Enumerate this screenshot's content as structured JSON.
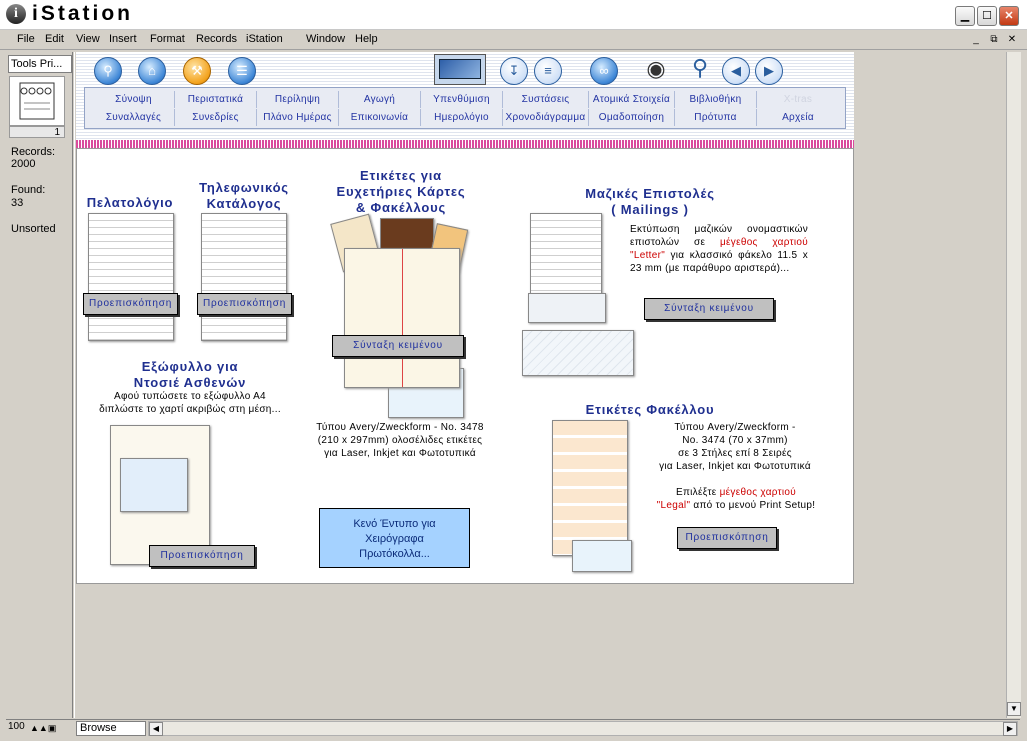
{
  "window": {
    "title": "iStation",
    "logo": "i",
    "minimize": "▁",
    "maximize": "☐",
    "close": "✕"
  },
  "menu": [
    "File",
    "Edit",
    "View",
    "Insert",
    "Format",
    "Records",
    "iStation",
    "Window",
    "Help"
  ],
  "mdi_controls": [
    "_",
    "⧉",
    "✕"
  ],
  "sidebar": {
    "layout_select": "Tools Pri...",
    "record_number": "1",
    "records_label": "Records:",
    "records_value": "2000",
    "found_label": "Found:",
    "found_value": "33",
    "sort_status": "Unsorted"
  },
  "toolbar": {
    "icons": [
      "search-icon",
      "home-icon",
      "tools-icon",
      "list-icon",
      "card-icon",
      "sort-down-icon",
      "sort-list-icon",
      "link-icon",
      "eye-icon",
      "magnifier-icon",
      "back-icon",
      "forward-icon"
    ],
    "nav_row1": [
      "Σύνοψη",
      "Περιστατικά",
      "Περίληψη",
      "Αγωγή",
      "Υπενθύμιση",
      "Συστάσεις",
      "Ατομικά Στοιχεία",
      "Βιβλιοθήκη",
      "X-tras"
    ],
    "nav_row2": [
      "Συναλλαγές",
      "Συνεδρίες",
      "Πλάνο Ημέρας",
      "Επικοινωνία",
      "Ημερολόγιο",
      "Χρονοδιάγραμμα",
      "Ομαδοποίηση",
      "Πρότυπα",
      "Αρχεία"
    ]
  },
  "page": {
    "client_list": {
      "title": "Πελατολόγιο",
      "button": "Προεπισκόπηση"
    },
    "phone_directory": {
      "title_line1": "Τηλεφωνικός",
      "title_line2": "Κατάλογος",
      "button": "Προεπισκόπηση"
    },
    "greeting_labels": {
      "title_line1": "Ετικέτες για",
      "title_line2": "Ευχετήριες Κάρτες",
      "title_line3": "& Φακέλλους",
      "button": "Σύνταξη κειμένου",
      "desc_line1": "Τύπου Avery/Zweckform - No. 3478",
      "desc_line2": "(210 x 297mm) ολοσέλιδες ετικέτες",
      "desc_line3": "για Laser, Inkjet και Φωτοτυπικά"
    },
    "mass_letters": {
      "title_line1": "Μαζικές Επιστολές",
      "title_line2": "( Mailings )",
      "desc_a": "Εκτύπωση μαζικών ονομαστικών επιστολών σε",
      "desc_red1": "μέγεθος χαρτιού \"Letter\"",
      "desc_b": "για κλασσικό φάκελο 11.5 x 23 mm (με παράθυρο αριστερά)...",
      "button": "Σύνταξη κειμένου"
    },
    "patient_cover": {
      "title_line1": "Εξώφυλλο για",
      "title_line2": "Ντοσιέ Ασθενών",
      "desc_line1": "Αφού τυπώσετε το εξώφυλλο Α4",
      "desc_line2": "διπλώστε το χαρτί ακριβώς στη μέση...",
      "button": "Προεπισκόπηση"
    },
    "blank_form": {
      "line1": "Κενό Έντυπο για",
      "line2": "Χειρόγραφα",
      "line3": "Πρωτόκολλα..."
    },
    "envelope_labels": {
      "title": "Ετικέτες Φακέλλου",
      "desc_line1": "Τύπου Avery/Zweckform -",
      "desc_line2": "No. 3474 (70 x 37mm)",
      "desc_line3": "σε 3 Στήλες επί 8 Σειρές",
      "desc_line4": "για Laser, Inkjet και Φωτοτυπικά",
      "select_a": "Επιλέξτε",
      "select_red1": "μέγεθος χαρτιού",
      "select_red2": "\"Legal\"",
      "select_b": "από το μενού Print Setup!",
      "button": "Προεπισκόπηση"
    }
  },
  "status": {
    "zoom": "100",
    "mode": "Browse"
  }
}
